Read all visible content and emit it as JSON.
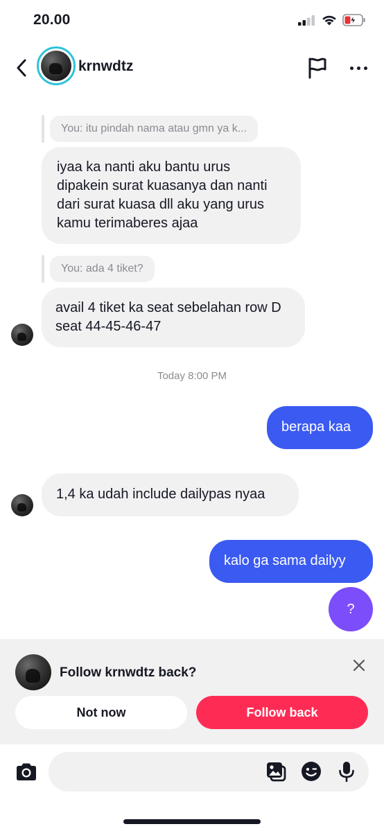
{
  "status_bar": {
    "time": "20.00",
    "icons": [
      "signal-icon",
      "wifi-icon",
      "battery-charging-icon"
    ]
  },
  "header": {
    "username": "krnwdtz",
    "icons": [
      "back-chevron-icon",
      "flag-icon",
      "more-icon"
    ]
  },
  "messages": {
    "reply1": "You: itu pindah nama atau gmn ya k...",
    "msg1": "iyaa ka nanti aku bantu urus dipakein surat kuasanya dan nanti dari surat kuasa dll aku yang urus kamu terimaberes ajaa",
    "reply2": "You: ada 4 tiket?",
    "msg2": "avail 4 tiket ka seat sebelahan row D seat 44-45-46-47",
    "timestamp": "Today 8:00 PM",
    "msg3": "berapa kaa",
    "msg4": "1,4 ka udah include dailypas nyaa",
    "msg5": "kalo ga sama dailyy",
    "msg6": "?"
  },
  "follow_prompt": {
    "text": "Follow krnwdtz back?",
    "not_now": "Not now",
    "follow_back": "Follow back"
  },
  "input": {
    "placeholder": "",
    "icons": [
      "camera-icon",
      "image-sticker-icon",
      "emoji-icon",
      "microphone-icon"
    ]
  },
  "colors": {
    "outgoing_bubble": "#3a5af1",
    "incoming_bubble": "#f1f1f2",
    "follow_button": "#fe2c55",
    "question_bubble": "#7c4dfa",
    "story_ring": "#2dc3d8"
  }
}
